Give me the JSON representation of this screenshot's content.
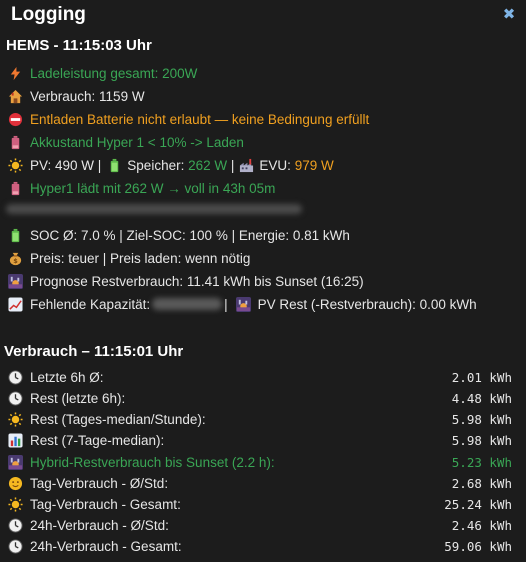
{
  "header": {
    "title": "Logging",
    "close_icon": "close-icon"
  },
  "hems": {
    "title": "HEMS - 11:15:03 Uhr",
    "lines": [
      {
        "icon": "bolt-icon",
        "text": "Ladeleistung gesamt: 200W"
      },
      {
        "icon": "house-icon",
        "text": "Verbrauch: 1159 W"
      },
      {
        "icon": "no-entry-icon",
        "text": "Entladen Batterie nicht erlaubt — keine Bedingung erfüllt"
      },
      {
        "icon": "battery-pink-icon",
        "text": "Akkustand Hyper 1 < 10% -> Laden"
      }
    ],
    "pv_line": {
      "pv_label": "PV: 490 W |",
      "speicher_label": "Speicher:",
      "speicher_value": "262 W",
      "sep": "|",
      "evu_label": "EVU:",
      "evu_value": "979 W"
    },
    "hyper_line": "Hyper1 lädt mit 262 W → voll in 43h 05m",
    "soc_line": "SOC Ø: 7.0 % | Ziel-SOC: 100 % | Energie: 0.81 kWh",
    "preis_line": "Preis: teuer | Preis laden: wenn nötig",
    "prognose_line": "Prognose Restverbrauch: 11.41 kWh bis Sunset (16:25)",
    "fehlend_line": {
      "label": "Fehlende Kapazität:",
      "sep": "|",
      "pv_rest": "PV Rest (-Restverbrauch): 0.00 kWh"
    }
  },
  "verbrauch": {
    "title": "Verbrauch – 11:15:01 Uhr",
    "rows": [
      {
        "icon": "clock-icon",
        "label": "Letzte 6h Ø:",
        "value": "2.01 kWh",
        "green": false
      },
      {
        "icon": "clock-icon",
        "label": "Rest (letzte 6h):",
        "value": "4.48 kWh",
        "green": false
      },
      {
        "icon": "sun-icon",
        "label": "Rest (Tages-median/Stunde):",
        "value": "5.98 kWh",
        "green": false
      },
      {
        "icon": "bar-chart-icon",
        "label": "Rest (7-Tage-median):",
        "value": "5.98 kWh",
        "green": false
      },
      {
        "icon": "sunset-icon",
        "label": "Hybrid-Restverbrauch bis Sunset (2.2 h):",
        "value": "5.23 kWh",
        "green": true
      },
      {
        "icon": "sun-face-icon",
        "label": "Tag-Verbrauch - Ø/Std:",
        "value": "2.68 kWh",
        "green": false
      },
      {
        "icon": "sun-icon",
        "label": "Tag-Verbrauch - Gesamt:",
        "value": "25.24 kWh",
        "green": false
      },
      {
        "icon": "clock-icon",
        "label": "24h-Verbrauch - Ø/Std:",
        "value": "2.46 kWh",
        "green": false
      },
      {
        "icon": "clock-icon",
        "label": "24h-Verbrauch - Gesamt:",
        "value": "59.06 kWh",
        "green": false
      }
    ]
  },
  "colors": {
    "background": "#1c1c1c",
    "green": "#3aa655",
    "orange": "#f0a020",
    "close": "#7fb4e6"
  }
}
